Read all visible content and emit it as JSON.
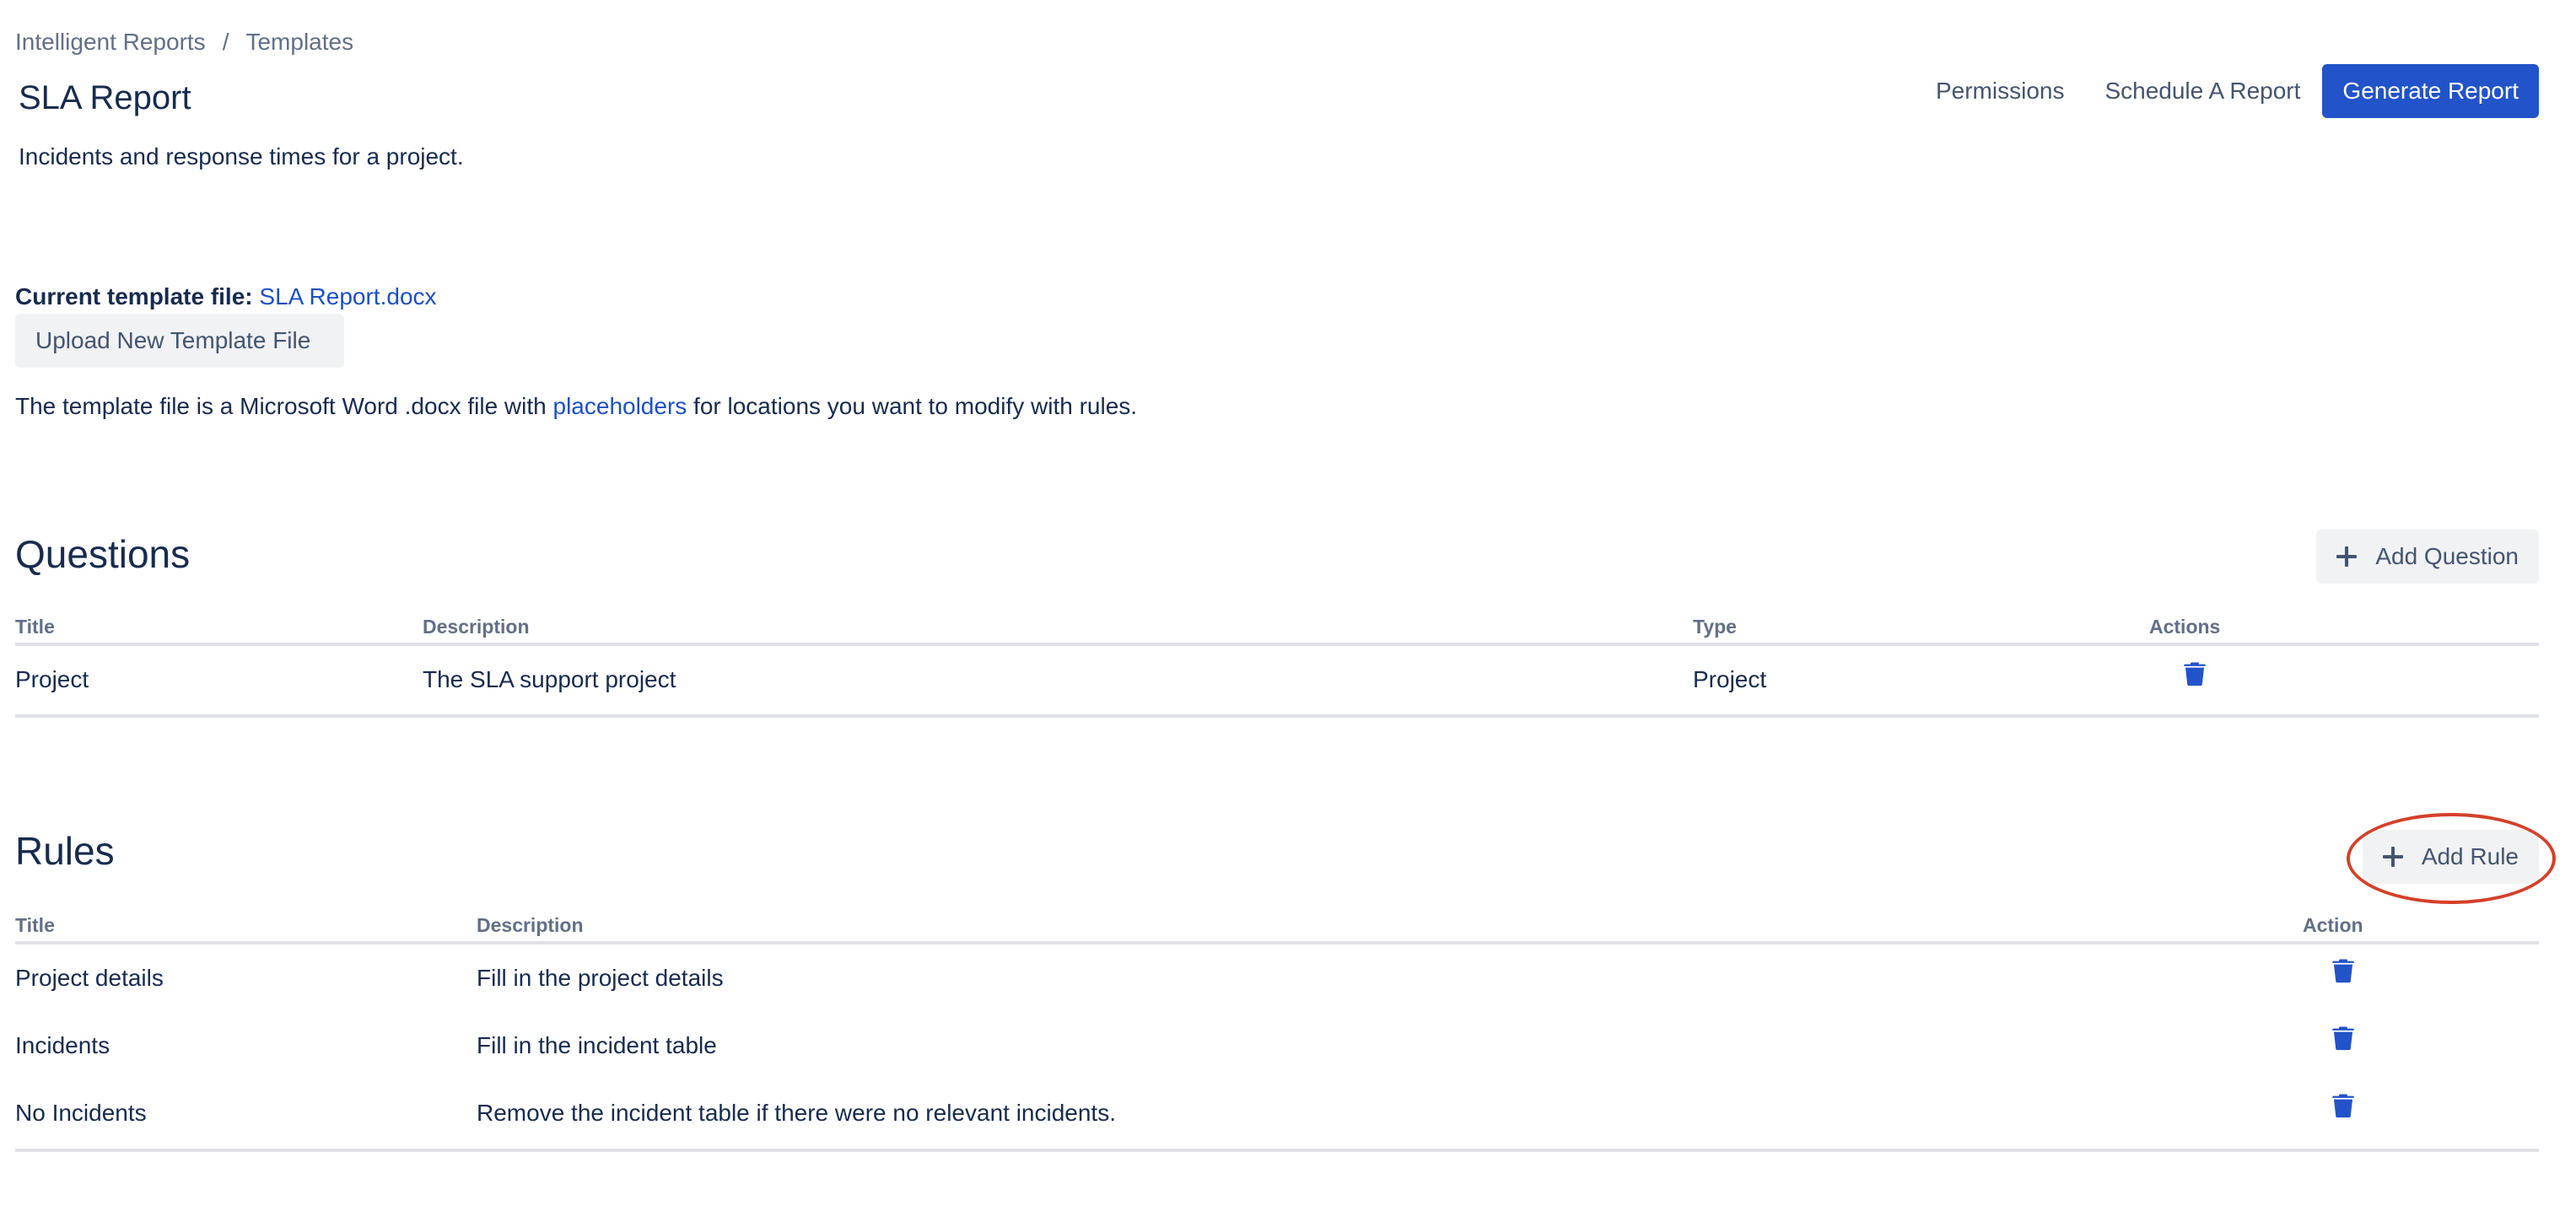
{
  "breadcrumb": {
    "items": [
      "Intelligent Reports",
      "Templates"
    ],
    "separator": "/"
  },
  "page": {
    "title": "SLA Report",
    "description": "Incidents and response times for a project."
  },
  "top_actions": {
    "permissions": "Permissions",
    "schedule": "Schedule A Report",
    "generate": "Generate Report"
  },
  "template": {
    "label": "Current template file:",
    "file_name": "SLA Report.docx",
    "upload_button": "Upload New Template File",
    "help_prefix": "The template file is a Microsoft Word .docx file with ",
    "help_link": "placeholders",
    "help_suffix": " for locations you want to modify with rules."
  },
  "questions": {
    "heading": "Questions",
    "add_button": "Add Question",
    "columns": [
      "Title",
      "Description",
      "Type",
      "Actions"
    ],
    "rows": [
      {
        "title": "Project",
        "description": "The SLA support project",
        "type": "Project",
        "action_icon": "trash-icon"
      }
    ]
  },
  "rules": {
    "heading": "Rules",
    "add_button": "Add Rule",
    "columns": [
      "Title",
      "Description",
      "Action"
    ],
    "rows": [
      {
        "title": "Project details",
        "description": "Fill in the project details",
        "action_icon": "trash-icon"
      },
      {
        "title": "Incidents",
        "description": "Fill in the incident table",
        "action_icon": "trash-icon"
      },
      {
        "title": "No Incidents",
        "description": "Remove the incident table if there were no relevant incidents.",
        "action_icon": "trash-icon"
      }
    ]
  },
  "colors": {
    "primary": "#2253c8",
    "link": "#1d4fc4",
    "text": "#172b4d",
    "subtle_text": "#626f86",
    "button_bg": "#f1f2f4",
    "border": "#dfe1e6",
    "annotation": "#d4402a",
    "trash_icon": "#2253c8"
  }
}
